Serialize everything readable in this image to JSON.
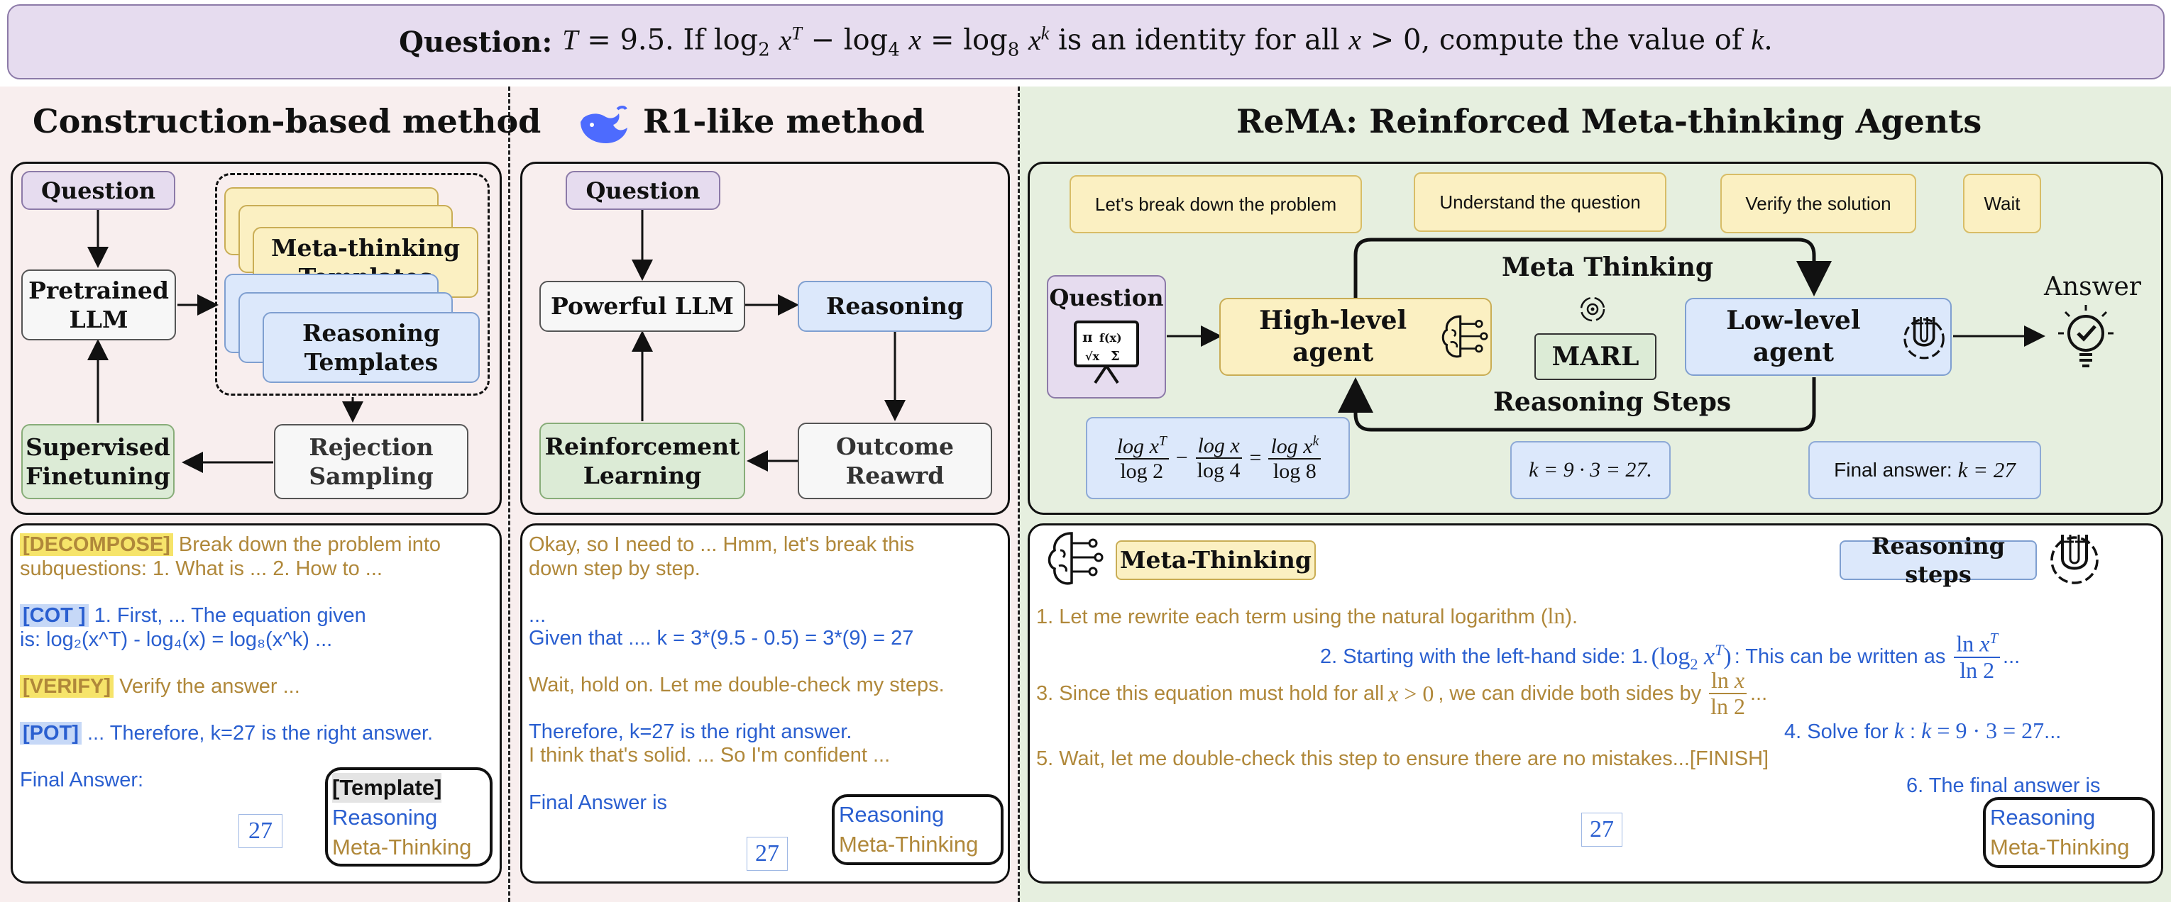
{
  "header": {
    "label": "Question:",
    "text": "T = 9.5. If log₂ xᵀ − log₄ x = log₈ xᵏ is an identity for all x > 0, compute the value of k."
  },
  "construction": {
    "title": "Construction-based method",
    "nodes": {
      "question": "Question",
      "pretrained": "Pretrained LLM",
      "meta_templates": "Meta-thinking Templates",
      "reasoning_templates": "Reasoning Templates",
      "supervised": "Supervised Finetuning",
      "rejection": "Rejection Sampling"
    },
    "text": {
      "l1_tag": "[DECOMPOSE]",
      "l1_a": "Break down the problem into",
      "l1_b": "subquestions: 1. What is ... 2. How to ...",
      "l2_tag": "[COT ]",
      "l2_a": "1. First, ... The equation given",
      "l2_b": "is: log₂(x^T) - log₄(x) = log₈(x^k) ...",
      "l3_tag": "[VERIFY]",
      "l3_a": "Verify the answer ...",
      "l4_tag": "[POT]",
      "l4_a": "... Therefore, k=27 is the right answer.",
      "final": "Final Answer:",
      "answer": "27"
    },
    "legend": {
      "template": "[Template]",
      "reasoning": "Reasoning",
      "meta": "Meta-Thinking"
    }
  },
  "r1": {
    "title": "R1-like method",
    "nodes": {
      "question": "Question",
      "llm": "Powerful LLM",
      "reasoning": "Reasoning",
      "rl": "Reinforcement Learning",
      "outcome": "Outcome Reawrd"
    },
    "text": {
      "l1": "Okay, so I need to ... Hmm, let's break this",
      "l2": "down step by step.",
      "l3": "...",
      "l4": "Given that .... k = 3*(9.5 - 0.5) = 3*(9) = 27",
      "l5": "Wait, hold on. Let me double-check my steps.",
      "l6": "Therefore, k=27 is the right answer.",
      "l7": "I think that's solid. ... So I'm confident ...",
      "final": "Final Answer is",
      "answer": "27"
    },
    "legend": {
      "reasoning": "Reasoning",
      "meta": "Meta-Thinking"
    }
  },
  "rema": {
    "title": "ReMA: Reinforced Meta-thinking Agents",
    "prompts": [
      "Let's break down the problem",
      "Understand the question",
      "Verify the solution",
      "Wait"
    ],
    "nodes": {
      "question": "Question",
      "high": "High-level agent",
      "marl": "MARL",
      "low": "Low-level agent",
      "meta_thinking": "Meta Thinking",
      "reasoning_steps": "Reasoning Steps",
      "answer": "Answer"
    },
    "boxes": {
      "middle": "k = 9 · 3 = 27.",
      "final_label": "Final answer:",
      "final_math": "k = 27"
    },
    "labels": {
      "meta": "Meta-Thinking",
      "reasoning": "Reasoning steps"
    },
    "text": {
      "s1": "1. Let me rewrite each term using the natural logarithm (ln).",
      "s2": "2. Starting with the left-hand side: 1. (log₂ xᵀ): This can be written as",
      "s3": "3. Since this equation must hold for all x > 0, we can divide both sides by",
      "s4": "4. Solve for k : k = 9 · 3 = 27...",
      "s5": "5. Wait, let me double-check this step to ensure there are no mistakes...[FINISH]",
      "s6": "6. The final answer is",
      "answer": "27"
    },
    "legend": {
      "reasoning": "Reasoning",
      "meta": "Meta-Thinking"
    }
  }
}
